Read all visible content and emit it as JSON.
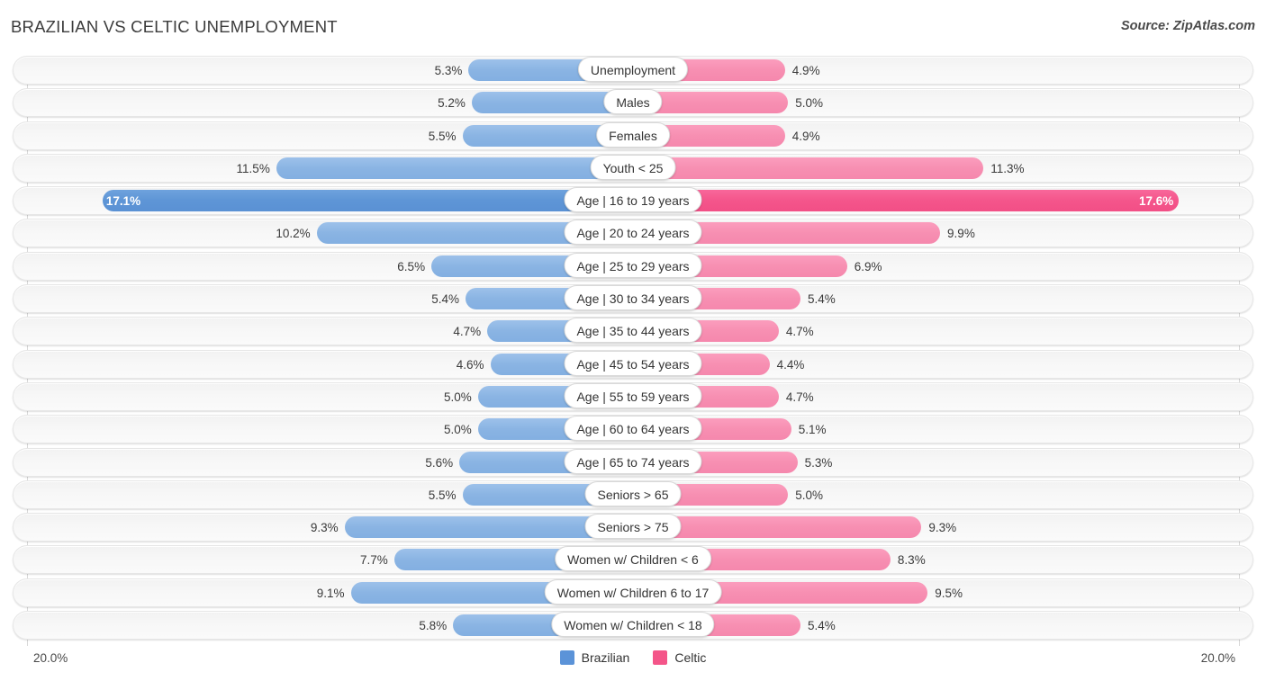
{
  "header": {
    "title": "BRAZILIAN VS CELTIC UNEMPLOYMENT",
    "source": "Source: ZipAtlas.com"
  },
  "axis": {
    "left_label": "20.0%",
    "right_label": "20.0%",
    "max": 20.0
  },
  "legend": [
    {
      "label": "Brazilian",
      "color": "#5b93d8"
    },
    {
      "label": "Celtic",
      "color": "#f45589"
    }
  ],
  "chart_data": {
    "type": "bar",
    "title": "BRAZILIAN VS CELTIC UNEMPLOYMENT",
    "subtitle": "Source: ZipAtlas.com",
    "orientation": "horizontal-diverging",
    "xlabel": "",
    "ylabel": "",
    "xlim": [
      20.0,
      20.0
    ],
    "grid": true,
    "legend_position": "bottom-center",
    "categories": [
      "Unemployment",
      "Males",
      "Females",
      "Youth < 25",
      "Age | 16 to 19 years",
      "Age | 20 to 24 years",
      "Age | 25 to 29 years",
      "Age | 30 to 34 years",
      "Age | 35 to 44 years",
      "Age | 45 to 54 years",
      "Age | 55 to 59 years",
      "Age | 60 to 64 years",
      "Age | 65 to 74 years",
      "Seniors > 65",
      "Seniors > 75",
      "Women w/ Children < 6",
      "Women w/ Children 6 to 17",
      "Women w/ Children < 18"
    ],
    "series": [
      {
        "name": "Brazilian",
        "color": "#8ab4e3",
        "values": [
          5.3,
          5.2,
          5.5,
          11.5,
          17.1,
          10.2,
          6.5,
          5.4,
          4.7,
          4.6,
          5.0,
          5.0,
          5.6,
          5.5,
          9.3,
          7.7,
          9.1,
          5.8
        ]
      },
      {
        "name": "Celtic",
        "color": "#f78fb2",
        "values": [
          4.9,
          5.0,
          4.9,
          11.3,
          17.6,
          9.9,
          6.9,
          5.4,
          4.7,
          4.4,
          4.7,
          5.1,
          5.3,
          5.0,
          9.3,
          8.3,
          9.5,
          5.4
        ]
      }
    ],
    "highlight_row": "Age | 16 to 19 years"
  },
  "rows": [
    {
      "label": "Unemployment",
      "left": "5.3%",
      "right": "4.9%",
      "lv": 5.3,
      "rv": 4.9,
      "hl": false
    },
    {
      "label": "Males",
      "left": "5.2%",
      "right": "5.0%",
      "lv": 5.2,
      "rv": 5.0,
      "hl": false
    },
    {
      "label": "Females",
      "left": "5.5%",
      "right": "4.9%",
      "lv": 5.5,
      "rv": 4.9,
      "hl": false
    },
    {
      "label": "Youth < 25",
      "left": "11.5%",
      "right": "11.3%",
      "lv": 11.5,
      "rv": 11.3,
      "hl": false
    },
    {
      "label": "Age | 16 to 19 years",
      "left": "17.1%",
      "right": "17.6%",
      "lv": 17.1,
      "rv": 17.6,
      "hl": true
    },
    {
      "label": "Age | 20 to 24 years",
      "left": "10.2%",
      "right": "9.9%",
      "lv": 10.2,
      "rv": 9.9,
      "hl": false
    },
    {
      "label": "Age | 25 to 29 years",
      "left": "6.5%",
      "right": "6.9%",
      "lv": 6.5,
      "rv": 6.9,
      "hl": false
    },
    {
      "label": "Age | 30 to 34 years",
      "left": "5.4%",
      "right": "5.4%",
      "lv": 5.4,
      "rv": 5.4,
      "hl": false
    },
    {
      "label": "Age | 35 to 44 years",
      "left": "4.7%",
      "right": "4.7%",
      "lv": 4.7,
      "rv": 4.7,
      "hl": false
    },
    {
      "label": "Age | 45 to 54 years",
      "left": "4.6%",
      "right": "4.4%",
      "lv": 4.6,
      "rv": 4.4,
      "hl": false
    },
    {
      "label": "Age | 55 to 59 years",
      "left": "5.0%",
      "right": "4.7%",
      "lv": 5.0,
      "rv": 4.7,
      "hl": false
    },
    {
      "label": "Age | 60 to 64 years",
      "left": "5.0%",
      "right": "5.1%",
      "lv": 5.0,
      "rv": 5.1,
      "hl": false
    },
    {
      "label": "Age | 65 to 74 years",
      "left": "5.6%",
      "right": "5.3%",
      "lv": 5.6,
      "rv": 5.3,
      "hl": false
    },
    {
      "label": "Seniors > 65",
      "left": "5.5%",
      "right": "5.0%",
      "lv": 5.5,
      "rv": 5.0,
      "hl": false
    },
    {
      "label": "Seniors > 75",
      "left": "9.3%",
      "right": "9.3%",
      "lv": 9.3,
      "rv": 9.3,
      "hl": false
    },
    {
      "label": "Women w/ Children < 6",
      "left": "7.7%",
      "right": "8.3%",
      "lv": 7.7,
      "rv": 8.3,
      "hl": false
    },
    {
      "label": "Women w/ Children 6 to 17",
      "left": "9.1%",
      "right": "9.5%",
      "lv": 9.1,
      "rv": 9.5,
      "hl": false
    },
    {
      "label": "Women w/ Children < 18",
      "left": "5.8%",
      "right": "5.4%",
      "lv": 5.8,
      "rv": 5.4,
      "hl": false
    }
  ]
}
